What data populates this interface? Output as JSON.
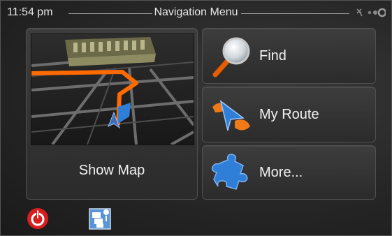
{
  "header": {
    "clock": "11:54 pm",
    "title": "Navigation Menu"
  },
  "tiles": {
    "show_map_label": "Show Map",
    "find_label": "Find",
    "my_route_label": "My Route",
    "more_label": "More..."
  },
  "icons": {
    "gps": "gps-signal-icon",
    "find": "magnifier-icon",
    "my_route": "route-arrow-icon",
    "more": "puzzle-icon",
    "power": "power-icon",
    "traffic": "traffic-info-icon"
  },
  "colors": {
    "route": "#ff6a00",
    "accent_blue": "#2f7fd8",
    "power_red": "#d81e1e"
  }
}
